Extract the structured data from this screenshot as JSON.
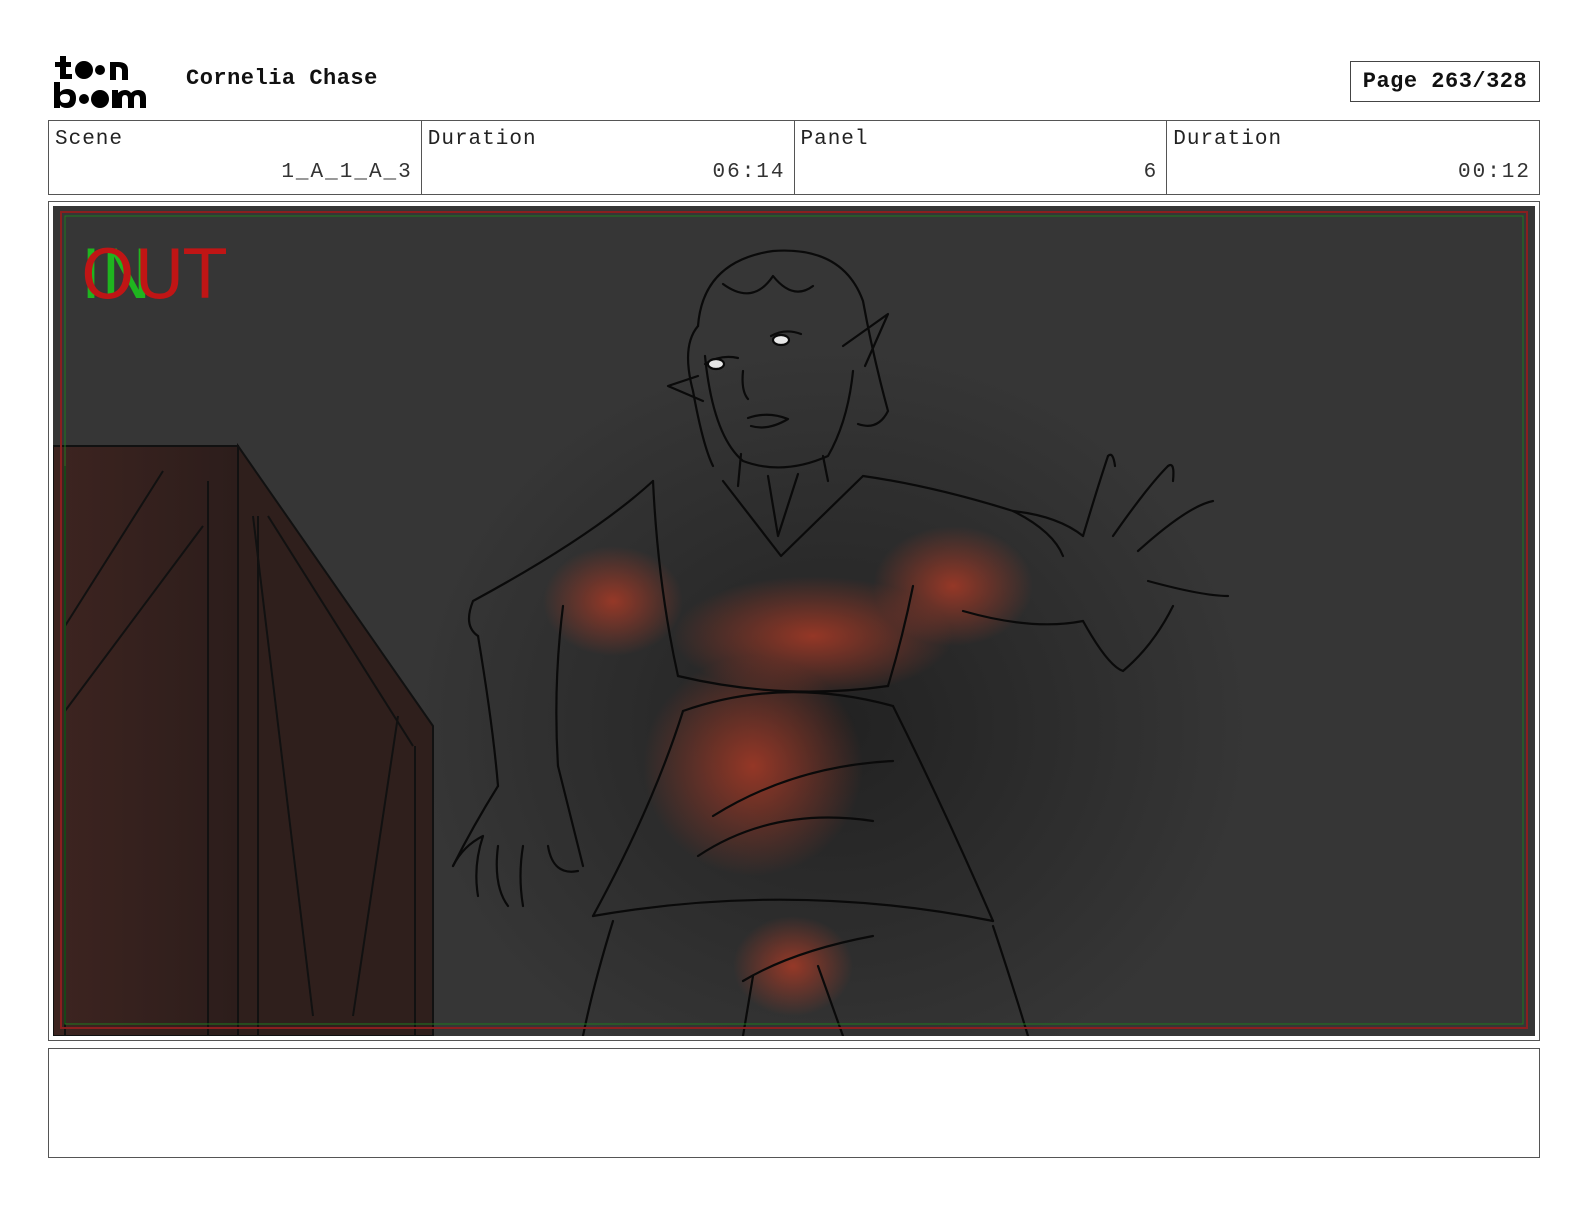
{
  "header": {
    "logo_text_top": "toon",
    "logo_text_bottom": "boom",
    "project_title": "Cornelia Chase",
    "page_label": "Page 263/328"
  },
  "info": [
    {
      "label": "Scene",
      "value": "1_A_1_A_3"
    },
    {
      "label": "Duration",
      "value": "06:14"
    },
    {
      "label": "Panel",
      "value": "6"
    },
    {
      "label": "Duration",
      "value": "00:12"
    }
  ],
  "panel": {
    "overlay_in": "IN",
    "overlay_out": "OUT",
    "colors": {
      "background": "#363636",
      "glow": "#a83a26",
      "crate": "#3a2420",
      "in_mark": "#1fb51f",
      "out_mark": "#c01515"
    }
  },
  "notes": {
    "text": ""
  }
}
